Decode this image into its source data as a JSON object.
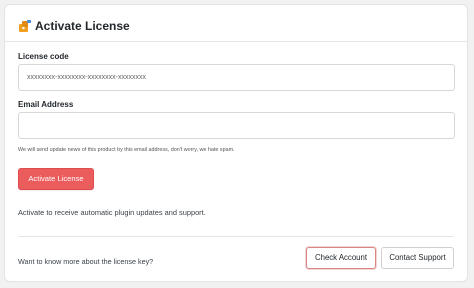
{
  "header": {
    "title": "Activate License",
    "icon": "key-icon"
  },
  "form": {
    "license_label": "License code",
    "license_placeholder": "xxxxxxxx-xxxxxxxx-xxxxxxxx-xxxxxxxx",
    "license_value": "",
    "email_label": "Email Address",
    "email_placeholder": "",
    "email_value": "",
    "email_help": "We will send update news of this product by this email address, don't worry, we hate spam.",
    "activate_button": "Activate License"
  },
  "note": "Activate to receive automatic plugin updates and support.",
  "footer": {
    "text": "Want to know more about the license key?",
    "check_account_button": "Check Account",
    "contact_support_button": "Contact Support"
  },
  "colors": {
    "primary": "#eb5c5c",
    "icon_orange": "#f0a020"
  }
}
